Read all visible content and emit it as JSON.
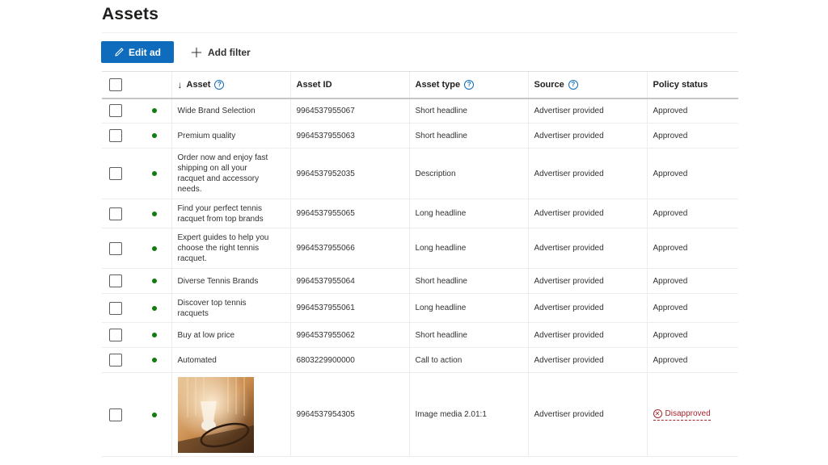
{
  "page": {
    "title": "Assets"
  },
  "toolbar": {
    "edit_label": "Edit ad",
    "add_filter_label": "Add filter"
  },
  "columns": {
    "asset": "Asset",
    "asset_id": "Asset ID",
    "asset_type": "Asset type",
    "source": "Source",
    "policy_status": "Policy status"
  },
  "rows": [
    {
      "asset": "Wide Brand Selection",
      "asset_id": "9964537955067",
      "asset_type": "Short headline",
      "source": "Advertiser provided",
      "policy_status": "Approved"
    },
    {
      "asset": "Premium quality",
      "asset_id": "9964537955063",
      "asset_type": "Short headline",
      "source": "Advertiser provided",
      "policy_status": "Approved"
    },
    {
      "asset": "Order now and enjoy fast shipping on all your racquet and accessory needs.",
      "asset_id": "9964537952035",
      "asset_type": "Description",
      "source": "Advertiser provided",
      "policy_status": "Approved"
    },
    {
      "asset": "Find your perfect tennis racquet from top brands",
      "asset_id": "9964537955065",
      "asset_type": "Long headline",
      "source": "Advertiser provided",
      "policy_status": "Approved"
    },
    {
      "asset": "Expert guides to help you choose the right tennis racquet.",
      "asset_id": "9964537955066",
      "asset_type": "Long headline",
      "source": "Advertiser provided",
      "policy_status": "Approved"
    },
    {
      "asset": "Diverse Tennis Brands",
      "asset_id": "9964537955064",
      "asset_type": "Short headline",
      "source": "Advertiser provided",
      "policy_status": "Approved"
    },
    {
      "asset": "Discover top tennis racquets",
      "asset_id": "9964537955061",
      "asset_type": "Long headline",
      "source": "Advertiser provided",
      "policy_status": "Approved"
    },
    {
      "asset": "Buy at low price",
      "asset_id": "9964537955062",
      "asset_type": "Short headline",
      "source": "Advertiser provided",
      "policy_status": "Approved"
    },
    {
      "asset": "Automated",
      "asset_id": "6803229900000",
      "asset_type": "Call to action",
      "source": "Advertiser provided",
      "policy_status": "Approved"
    },
    {
      "asset": "",
      "asset_id": "9964537954305",
      "asset_type": "Image media 2.01:1",
      "source": "Advertiser provided",
      "policy_status": "Disapproved"
    }
  ],
  "colors": {
    "primary": "#0f6cbd",
    "status_dot": "#107c10",
    "disapproved": "#a4262c"
  },
  "icons": {
    "edit": "pencil-icon",
    "add": "plus-icon",
    "help": "help-circle-icon",
    "sort": "arrow-down-icon",
    "error": "x-circle-icon"
  }
}
